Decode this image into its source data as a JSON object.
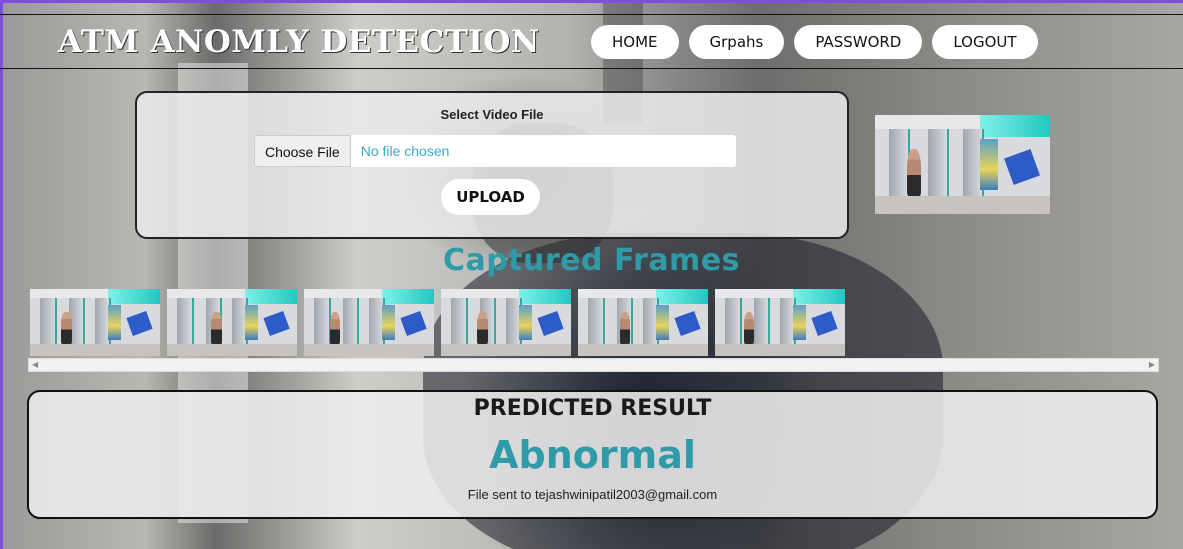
{
  "header": {
    "brand": "ATM ANOMLY DETECTION",
    "nav": [
      "HOME",
      "Grpahs",
      "PASSWORD",
      "LOGOUT"
    ]
  },
  "upload": {
    "title": "Select Video File",
    "choose_label": "Choose File",
    "file_status": "No file chosen",
    "button": "UPLOAD"
  },
  "frames": {
    "title": "Captured Frames",
    "count": 6
  },
  "result": {
    "title": "PREDICTED RESULT",
    "value": "Abnormal",
    "note": "File sent to tejashwinipatil2003@gmail.com"
  },
  "colors": {
    "accent": "#2f9aa8",
    "window_border": "#7b4fe0",
    "file_status": "#3aa8d0"
  }
}
